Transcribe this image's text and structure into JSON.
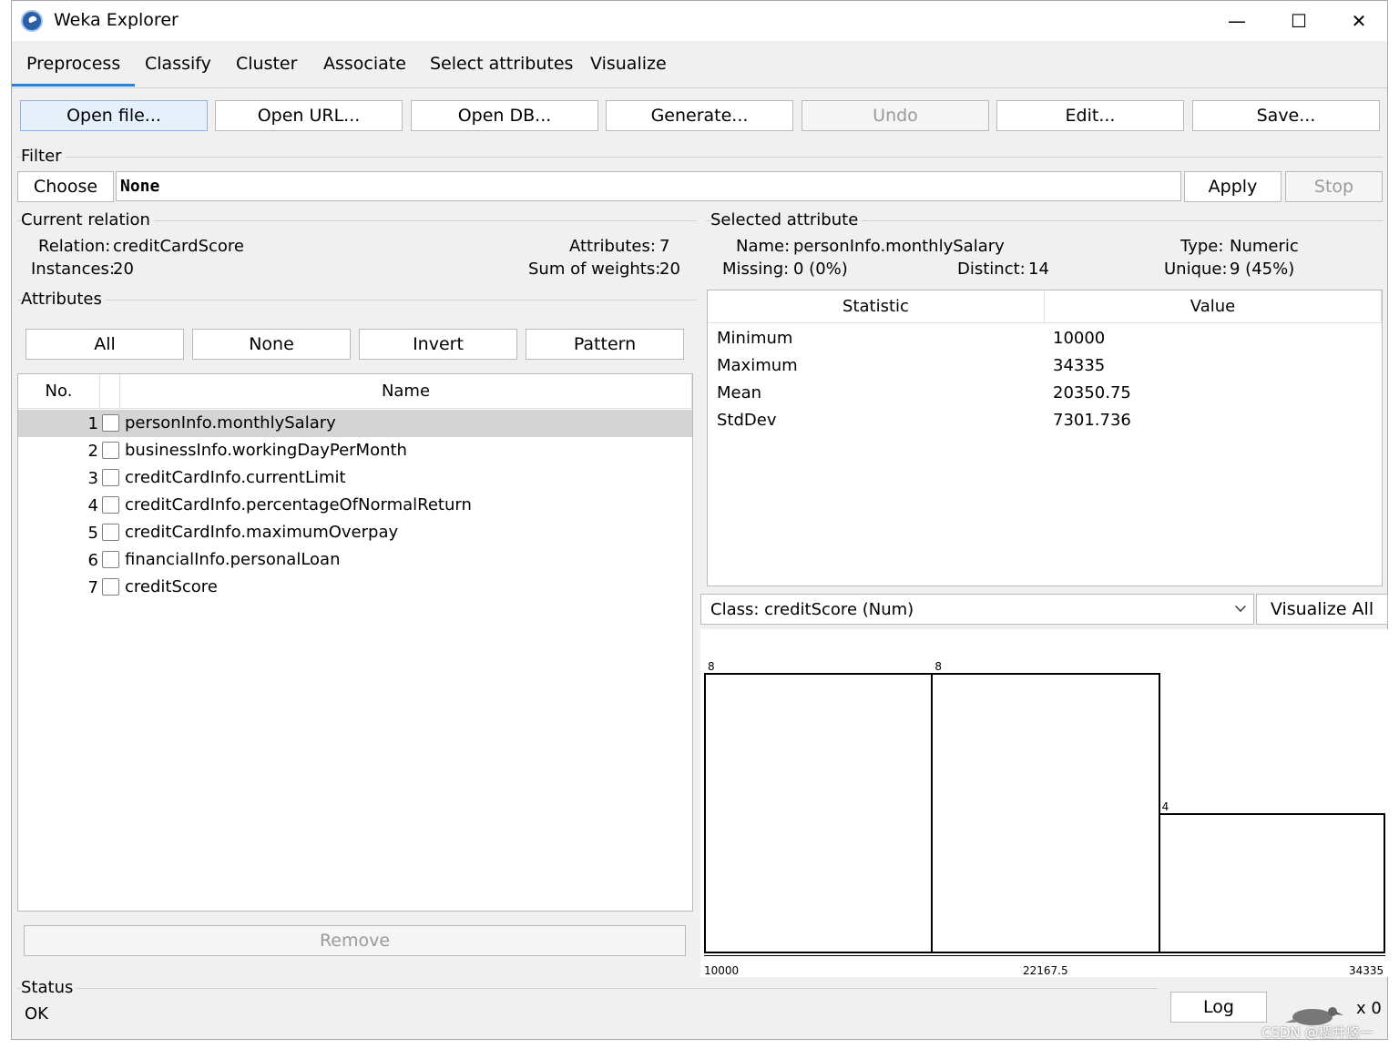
{
  "window": {
    "title": "Weka Explorer",
    "min": "—",
    "max": "☐",
    "close": "✕"
  },
  "tabs": [
    "Preprocess",
    "Classify",
    "Cluster",
    "Associate",
    "Select attributes",
    "Visualize"
  ],
  "toolbar": [
    "Open file...",
    "Open URL...",
    "Open DB...",
    "Generate...",
    "Undo",
    "Edit...",
    "Save..."
  ],
  "filter": {
    "label": "Filter",
    "choose": "Choose",
    "value": "None",
    "apply": "Apply",
    "stop": "Stop"
  },
  "relation": {
    "label": "Current relation",
    "relation_label": "Relation:",
    "relation_value": "creditCardScore",
    "instances_label": "Instances:",
    "instances_value": "20",
    "attributes_label": "Attributes:",
    "attributes_value": "7",
    "sum_label": "Sum of weights:",
    "sum_value": "20"
  },
  "attributes": {
    "label": "Attributes",
    "buttons": [
      "All",
      "None",
      "Invert",
      "Pattern"
    ],
    "col_no": "No.",
    "col_name": "Name",
    "rows": [
      {
        "no": "1",
        "name": "personInfo.monthlySalary"
      },
      {
        "no": "2",
        "name": "businessInfo.workingDayPerMonth"
      },
      {
        "no": "3",
        "name": "creditCardInfo.currentLimit"
      },
      {
        "no": "4",
        "name": "creditCardInfo.percentageOfNormalReturn"
      },
      {
        "no": "5",
        "name": "creditCardInfo.maximumOverpay"
      },
      {
        "no": "6",
        "name": "financialInfo.personalLoan"
      },
      {
        "no": "7",
        "name": "creditScore"
      }
    ],
    "remove": "Remove"
  },
  "selected": {
    "label": "Selected attribute",
    "name_label": "Name:",
    "name_value": "personInfo.monthlySalary",
    "type_label": "Type:",
    "type_value": "Numeric",
    "missing_label": "Missing:",
    "missing_value": "0 (0%)",
    "distinct_label": "Distinct:",
    "distinct_value": "14",
    "unique_label": "Unique:",
    "unique_value": "9 (45%)",
    "col_stat": "Statistic",
    "col_value": "Value",
    "stats": [
      {
        "stat": "Minimum",
        "value": "10000"
      },
      {
        "stat": "Maximum",
        "value": "34335"
      },
      {
        "stat": "Mean",
        "value": "20350.75"
      },
      {
        "stat": "StdDev",
        "value": "7301.736"
      }
    ]
  },
  "class_combo": "Class: creditScore (Num)",
  "visualize_all": "Visualize All",
  "chart_data": {
    "type": "bar",
    "categories": [
      "10000–18111.67",
      "18111.67–26223.33",
      "26223.33–34335"
    ],
    "values": [
      8,
      8,
      4
    ],
    "value_labels": [
      "8",
      "8",
      "4"
    ],
    "x_tick_labels": [
      "10000",
      "22167.5",
      "34335"
    ],
    "ylim": [
      0,
      8
    ],
    "title": "",
    "xlabel": "",
    "ylabel": ""
  },
  "status": {
    "label": "Status",
    "text": "OK",
    "log": "Log",
    "count": "x 0"
  },
  "watermark": "CSDN @樱井悠一"
}
